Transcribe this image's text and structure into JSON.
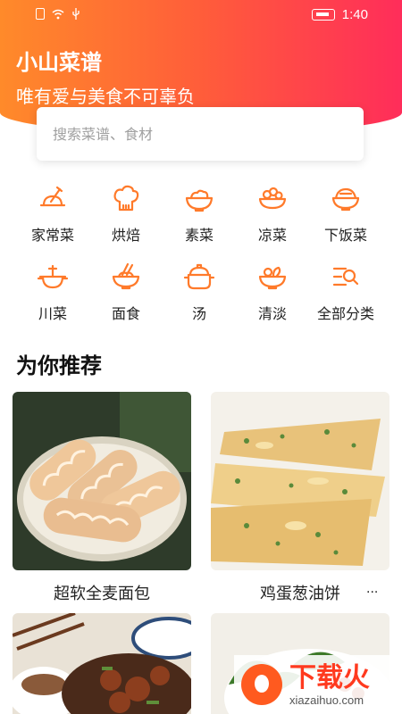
{
  "status_bar": {
    "time": "1:40"
  },
  "header": {
    "title": "小山菜谱",
    "subtitle": "唯有爱与美食不可辜负"
  },
  "search": {
    "placeholder": "搜索菜谱、食材"
  },
  "categories": [
    {
      "label": "家常菜",
      "icon": "chef-hat-icon"
    },
    {
      "label": "烘焙",
      "icon": "toque-icon"
    },
    {
      "label": "素菜",
      "icon": "veggie-bowl-icon"
    },
    {
      "label": "凉菜",
      "icon": "cold-dish-icon"
    },
    {
      "label": "下饭菜",
      "icon": "rice-bowl-icon"
    },
    {
      "label": "川菜",
      "icon": "hotpot-icon"
    },
    {
      "label": "面食",
      "icon": "noodle-bowl-icon"
    },
    {
      "label": "汤",
      "icon": "soup-pot-icon"
    },
    {
      "label": "清淡",
      "icon": "salad-icon"
    },
    {
      "label": "全部分类",
      "icon": "all-categories-icon"
    }
  ],
  "recommend": {
    "title": "为你推荐",
    "items": [
      {
        "name": "超软全麦面包"
      },
      {
        "name": "鸡蛋葱油饼"
      },
      {
        "name": ""
      },
      {
        "name": ""
      }
    ],
    "more": "..."
  },
  "watermark": {
    "title": "下载火",
    "sub": "xiazaihuo.com"
  },
  "colors": {
    "accent": "#ff7a2a",
    "gradient_start": "#ff8a2a",
    "gradient_end": "#ff2d5a"
  }
}
